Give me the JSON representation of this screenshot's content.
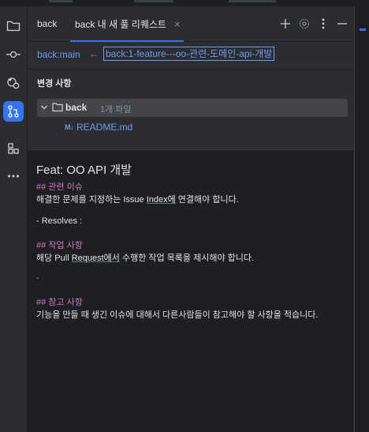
{
  "sidebar": {
    "items": [
      {
        "icon": "folder-icon"
      },
      {
        "icon": "commit-icon"
      },
      {
        "icon": "pull-requests-icon"
      },
      {
        "icon": "branch-compare-icon",
        "active": true
      },
      {
        "icon": "structure-icon"
      },
      {
        "icon": "more-icon"
      }
    ]
  },
  "tabs": {
    "items": [
      {
        "label": "back"
      },
      {
        "label": "back 내 새 풀 리퀘스트"
      }
    ],
    "close_symbol": "×",
    "tools": [
      "plus-icon",
      "settings-icon",
      "more-vertical-icon",
      "minimize-icon"
    ]
  },
  "branches": {
    "base": "back:main",
    "arrow": "←",
    "head": "back:1-feature---oo-관련-도메인-api-개발"
  },
  "changes": {
    "title": "변경 사항",
    "folder": {
      "name": "back",
      "count": "1개 파일"
    },
    "files": [
      {
        "icon": "markdown-icon",
        "icon_text": "M↓",
        "name": "README.md"
      }
    ]
  },
  "description": {
    "title": "Feat: OO API 개발",
    "h1_marker": "##",
    "h1_text": " 관련 이슈",
    "p1a": "해결한 문제를 지정하는 Issue ",
    "p1b": "Index에",
    "p1c": " 연결해야 합니다.",
    "resolves": "- Resolves :",
    "h2_marker": "##",
    "h2_text": " 작업 사항",
    "p2a": "해당 Pull ",
    "p2b": "Request에서",
    "p2c": " 수행한 작업 목록을 제시해야 합니다.",
    "dash": "-",
    "h3_marker": "##",
    "h3_text": " 참고 사항",
    "p3": "기능을 만들 때 생긴 이슈에 대해서 다른사람들이 참고해야 할 사항을 적습니다."
  },
  "colors": {
    "accent": "#3574f0",
    "link": "#6e9bef",
    "heading": "#c77dbb",
    "dash": "#cf8e6d",
    "background": "#2b2d30",
    "editor": "#1e1f22"
  }
}
